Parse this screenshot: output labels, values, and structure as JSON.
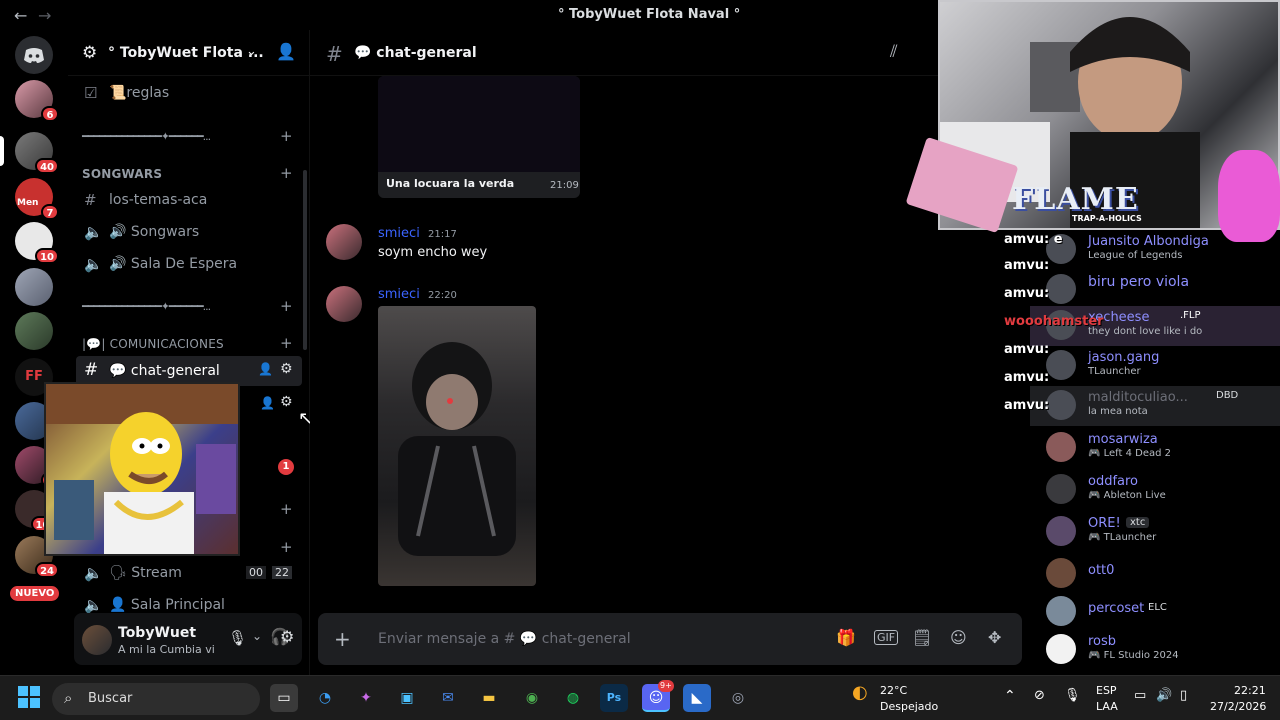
{
  "window": {
    "title": "° TobyWuet Flota Naval °",
    "back": "←",
    "forward": "→"
  },
  "servers": [
    {
      "badge": "6"
    },
    {
      "badge": "40"
    },
    {
      "badge": "7",
      "label": "Men"
    },
    {
      "badge": "10"
    },
    {
      "badge": ""
    },
    {
      "badge": ""
    },
    {
      "badge": ""
    },
    {
      "badge": "1"
    },
    {
      "badge": "1"
    },
    {
      "badge": "10!"
    },
    {
      "badge": "24"
    },
    {
      "badge": "NUEVO"
    }
  ],
  "sidebar": {
    "server_name": "° TobyWuet Flota ...",
    "rules_channel": "📜reglas",
    "divider_1": "━━━━━━━━━━━━━━✦━━━━━━...",
    "cat_songwars": "SONGWARS",
    "ch_los_temas": "los-temas-aca",
    "ch_songwars": "🔊 Songwars",
    "ch_sala_espera": "🔊 Sala De Espera",
    "divider_2": "━━━━━━━━━━━━━━✦━━━━━━...",
    "cat_comunicaciones": "|💬| COMUNICACIONES",
    "ch_chat_general": "💬 chat-general",
    "unread_badge": "1",
    "ch_stream": "🗣 Stream",
    "stream_counts": "00",
    "stream_counts2": "22",
    "ch_sala_principal": "👤 Sala Principal"
  },
  "user": {
    "name": "TobyWuet",
    "status": "A mi la Cumbia vi"
  },
  "chat": {
    "channel": "💬 chat-general",
    "embed_caption": "Una locuara la verda",
    "embed_time": "21:09",
    "messages": [
      {
        "author": "smieci",
        "time": "21:17",
        "text": "soym encho wey"
      },
      {
        "author": "smieci",
        "time": "22:20",
        "text": ""
      }
    ],
    "composer_placeholder": "Enviar mensaje a # 💬 chat-general"
  },
  "stream_overlay": {
    "brand": "FLAME",
    "brand_sub": "TRAP-A-HOLICS",
    "lines": [
      {
        "user": "amvu:",
        "text": "e"
      },
      {
        "user": "amvu:",
        "text": ""
      },
      {
        "user": "amvu:",
        "text": ""
      },
      {
        "user": "wooohamster",
        "text": ""
      },
      {
        "user": "amvu:",
        "text": ""
      },
      {
        "user": "amvu:",
        "text": ""
      },
      {
        "user": "amvu:",
        "text": ""
      }
    ]
  },
  "members": [
    {
      "name": "Juansito Albondiga",
      "activity": "League of Legends",
      "tag": ""
    },
    {
      "name": "biru pero viola",
      "activity": "",
      "tag": ""
    },
    {
      "name": "xecheese",
      "activity": "they dont love like i do",
      "tag": ".FLP"
    },
    {
      "name": "jason.gang",
      "activity": "TLauncher",
      "tag": ""
    },
    {
      "name": "malditoculiao...",
      "activity": "la mea nota",
      "tag": "DBD"
    },
    {
      "name": "mosarwiza",
      "activity": "🎮 Left 4 Dead 2",
      "tag": ""
    },
    {
      "name": "oddfaro",
      "activity": "🎮 Ableton Live",
      "tag": ""
    },
    {
      "name": "ORE!",
      "activity": "🎮 TLauncher",
      "tag": "xtc"
    },
    {
      "name": "ott0",
      "activity": "",
      "tag": ""
    },
    {
      "name": "percoset",
      "activity": "",
      "tag": "ELC"
    },
    {
      "name": "rosb",
      "activity": "🎮 FL Studio 2024",
      "tag": ""
    }
  ],
  "taskbar": {
    "search_label": "Buscar",
    "weather_temp": "22°C",
    "weather_desc": "Despejado",
    "lang1": "ESP",
    "lang2": "LAA",
    "time": "22:21",
    "date": "27/2/2026",
    "discord_badge": "9+"
  },
  "colors": {
    "author": "#3b64ff",
    "background": "#000000",
    "composer": "#1e1f22",
    "badge": "#e23b3f"
  }
}
